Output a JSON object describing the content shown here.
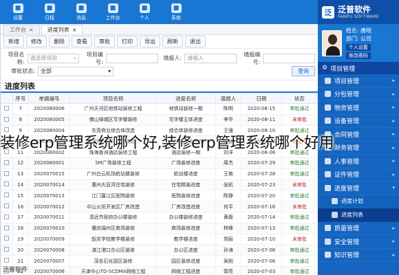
{
  "brand": {
    "name": "泛普软件",
    "sub": "FANPU SOFTWARE"
  },
  "user": {
    "name_line": "姓名: 唐晓",
    "dept_line": "部门: 公司",
    "btn1": "个人设置",
    "btn2": "修改密码"
  },
  "sidebar": {
    "head": "项目管理",
    "items": [
      {
        "label": "项目管理",
        "chevron": "▸"
      },
      {
        "label": "分包管理",
        "chevron": "▸"
      },
      {
        "label": "物资管理",
        "chevron": "▸"
      },
      {
        "label": "设备管理",
        "chevron": "▸"
      },
      {
        "label": "合同管理",
        "chevron": "▸"
      },
      {
        "label": "财务管理",
        "chevron": "▸"
      },
      {
        "label": "人事管理",
        "chevron": "▸"
      },
      {
        "label": "证件管理",
        "chevron": "▸"
      },
      {
        "label": "进度管理",
        "chevron": "▾"
      },
      {
        "label": "进度计划",
        "sub": true
      },
      {
        "label": "进度列表",
        "sub": true,
        "active": true
      },
      {
        "label": "质量管理",
        "chevron": "▸"
      },
      {
        "label": "安全管理",
        "chevron": "▸"
      },
      {
        "label": "知识管理",
        "chevron": "▸"
      }
    ]
  },
  "topbar": {
    "buttons": [
      "系统",
      "个人",
      "工作台",
      "消息",
      "日程",
      "设置"
    ]
  },
  "tabs": [
    {
      "label": "工作台",
      "active": false
    },
    {
      "label": "进度列表",
      "active": true
    }
  ],
  "toolbar": {
    "buttons": [
      "新增",
      "修改",
      "删除",
      "查看",
      "审批",
      "打印",
      "导出",
      "刷新",
      "退出"
    ]
  },
  "filters": {
    "row1": [
      {
        "label": "项目名称:",
        "placeholder": "请选择项目"
      },
      {
        "label": "项目编号:",
        "placeholder": ""
      },
      {
        "label": "填报人:",
        "placeholder": "请输入"
      },
      {
        "label": "填报编号:",
        "placeholder": ""
      }
    ],
    "row2": [
      {
        "label": "审批状态:",
        "value": "全部"
      },
      {
        "label": "",
        "value": ""
      }
    ],
    "search_label": "查询"
  },
  "section_title": "进度列表",
  "table": {
    "headers": [
      "",
      "序号",
      "单据编号",
      "项目名称",
      "进度名称",
      "填报人",
      "日期",
      "状态"
    ],
    "rows": [
      [
        "7",
        "2020080006",
        "广州天河区地铁站装修工程",
        "地铁站装修一期",
        "陈明",
        "2020-08-15",
        "审批通过"
      ],
      [
        "8",
        "2020080005",
        "佛山禅城区写字楼装修",
        "写字楼主体进度",
        "李华",
        "2020-08-11",
        "未审批"
      ],
      [
        "9",
        "2020080004",
        "东莞商业综合体改造",
        "综合体装修进度",
        "王强",
        "2020-08-10",
        "审批通过"
      ],
      [
        "10",
        "2020080003",
        "深圳南山科技园装修",
        "科技园装修进度",
        "赵敏",
        "2020-08-09",
        "审批中"
      ],
      [
        "11",
        "2020080002",
        "珠海香洲酒店装修工程",
        "酒店装修一期",
        "刘洋",
        "2020-08-06",
        "审批通过"
      ],
      [
        "12",
        "2020080001",
        "SM广场装修工程",
        "广场装修进度",
        "周杰",
        "2020-07-29",
        "审批通过"
      ],
      [
        "13",
        "2020070015",
        "广州白云机场航站楼装修",
        "航站楼进度",
        "王艳",
        "2020-07-28",
        "审批通过"
      ],
      [
        "14",
        "2020070014",
        "惠州大亚湾住宅装修",
        "住宅精装进度",
        "张凯",
        "2020-07-23",
        "未审批"
      ],
      [
        "15",
        "2020070013",
        "江门蓬江区医院装修",
        "医院装修进度",
        "陈静",
        "2020-07-20",
        "审批通过"
      ],
      [
        "16",
        "2020070012",
        "中山火炬开发区厂房改造",
        "厂房改造进度",
        "何平",
        "2020-07-16",
        "未审批"
      ],
      [
        "17",
        "2020070011",
        "清远市政府办公楼装修",
        "办公楼装修进度",
        "黄磊",
        "2020-07-14",
        "审批通过"
      ],
      [
        "18",
        "2020070010",
        "肇庆端州区商场装修",
        "商场装修进度",
        "林峰",
        "2020-07-13",
        "审批通过"
      ],
      [
        "19",
        "2020070009",
        "韶关学校教学楼装修",
        "教学楼进度",
        "郑丽",
        "2020-07-10",
        "未审批"
      ],
      [
        "20",
        "2020070008",
        "湛江港口办公区装修",
        "办公区进度",
        "孙涛",
        "2020-07-08",
        "审批通过"
      ],
      [
        "21",
        "2020070007",
        "茂名石化园区装修",
        "园区装修进度",
        "吴刚",
        "2020-07-06",
        "审批通过"
      ],
      [
        "22",
        "2020070006",
        "天津中心TD-SCDMA网络工程",
        "网络工程进度",
        "郭亮",
        "2020-07-03",
        "审批通过"
      ]
    ]
  },
  "watermark": "装修erp管理系统哪个好,装修erp管理系统哪个好用",
  "corner_logo": "泛普软件",
  "colors": {
    "primary": "#1976d2",
    "sidebar": "#1565c0",
    "ok": "#2e7d32",
    "pending": "#c62828"
  }
}
